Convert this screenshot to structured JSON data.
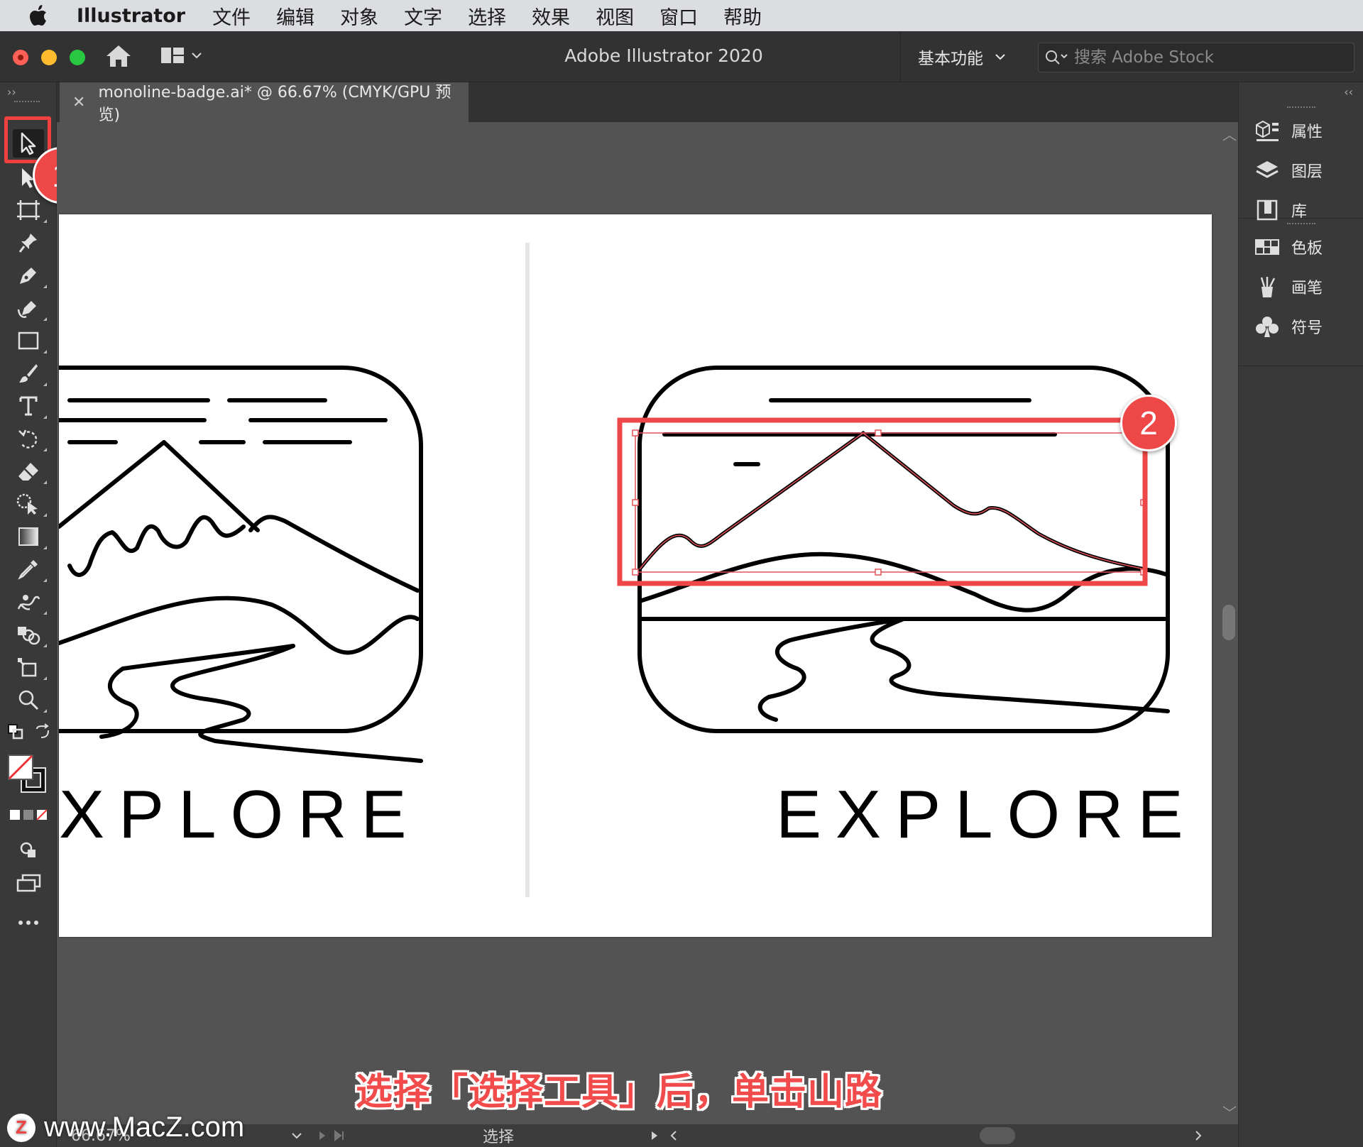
{
  "menubar": {
    "app_name": "Illustrator",
    "items": [
      "文件",
      "编辑",
      "对象",
      "文字",
      "选择",
      "效果",
      "视图",
      "窗口",
      "帮助"
    ]
  },
  "appbar": {
    "title": "Adobe Illustrator 2020",
    "workspace": "基本功能",
    "search_placeholder": "搜索 Adobe Stock"
  },
  "document": {
    "tab_title": "monoline-badge.ai* @ 66.67% (CMYK/GPU 预览)"
  },
  "artwork": {
    "left_text": "XPLORE",
    "right_text": "EXPLORE"
  },
  "annotations": {
    "badge_1": "1",
    "badge_2": "2",
    "caption": "选择「选择工具」后，单击山路",
    "highlight_color": "#ee4747"
  },
  "statusbar": {
    "zoom": "66.67%",
    "mode": "选择"
  },
  "watermark": {
    "logo_letter": "Z",
    "text": "www.MacZ.com"
  },
  "right_panel": {
    "group1": [
      "属性",
      "图层",
      "库"
    ],
    "group2": [
      "色板",
      "画笔",
      "符号"
    ]
  },
  "tools": [
    "selection-tool",
    "direct-selection-tool",
    "artboard-tool",
    "pin-tool",
    "pen-tool",
    "curvature-tool",
    "rectangle-tool",
    "paintbrush-tool",
    "type-tool",
    "rotate-tool",
    "eraser-tool",
    "shape-builder-tool",
    "gradient-tool",
    "eyedropper-tool",
    "puppet-warp-tool",
    "blend-tool",
    "free-transform-tool",
    "zoom-tool"
  ]
}
